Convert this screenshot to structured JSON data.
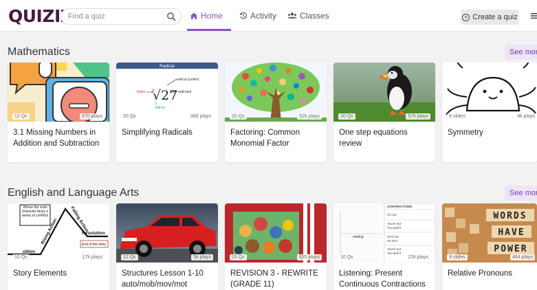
{
  "header": {
    "logo": "QUIZIZZ",
    "search_placeholder": "Find a quiz",
    "nav": [
      {
        "label": "Home",
        "icon": "home-icon",
        "active": true
      },
      {
        "label": "Activity",
        "icon": "history-icon"
      },
      {
        "label": "Classes",
        "icon": "users-icon"
      }
    ],
    "create_label": "Create a quiz",
    "accent_color": "#8854c0"
  },
  "sections": [
    {
      "title": "Mathematics",
      "see_more": "See more",
      "cards": [
        {
          "title": "3.1 Missing Numbers in Addition and Subtraction",
          "count": "12 Qs",
          "plays": "670 plays"
        },
        {
          "title": "Simplifying Radicals",
          "count": "20 Qs",
          "plays": "386 plays",
          "thumb_text": [
            "Radical",
            "radical symbol",
            "index",
            "radicand",
            "radical",
            "2",
            "√27"
          ]
        },
        {
          "title": "Factoring: Common Monomial Factor",
          "count": "20 Qs",
          "plays": "52k plays"
        },
        {
          "title": "One step equations review",
          "count": "20 Qs",
          "plays": "57k plays"
        },
        {
          "title": "Symmetry",
          "count": "8 slides",
          "plays": "4k plays"
        }
      ]
    },
    {
      "title": "English and Language Arts",
      "see_more": "See more",
      "cards": [
        {
          "title": "Story Elements",
          "count": "10 Qs",
          "plays": "17k plays",
          "thumb_text": [
            "Where the main character faces a series of conflicts",
            "Rising Action",
            "Falling Action",
            "Resolution",
            "End of the story",
            "olition"
          ]
        },
        {
          "title": "Structures Lesson 1-10 auto/mob/mov/mot",
          "count": "12 Qs",
          "plays": "5k plays"
        },
        {
          "title": "REVISION 3 - REWRITE (GRADE 11)",
          "count": "15 Qs",
          "plays": "635 plays"
        },
        {
          "title": "Listening: Present Continuous Contractions",
          "count": "10 Qs",
          "plays": "22k plays",
          "thumb_text": [
            "CONTRACTIONS",
            "I'm not",
            "You're not",
            "You aren't",
            "waiting",
            "He's not",
            "He isn't",
            "You're not",
            "You aren't"
          ]
        },
        {
          "title": "Relative Pronouns",
          "count": "9 slides",
          "plays": "464 plays",
          "thumb_text": [
            "WORDS",
            "HAVE",
            "POWER"
          ]
        }
      ]
    }
  ]
}
